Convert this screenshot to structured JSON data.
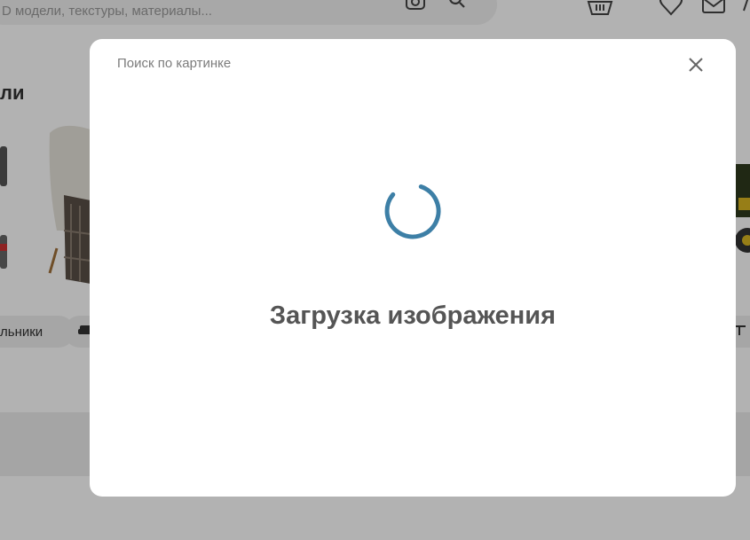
{
  "header": {
    "search_placeholder": "D модели, текстуры, материалы...",
    "icons": [
      "camera-search-icon",
      "search-icon",
      "basket-icon",
      "heart-icon",
      "mail-icon",
      "user-icon"
    ]
  },
  "background": {
    "section_title": "ли",
    "category_pills": [
      {
        "label": "льники"
      },
      {
        "label": ""
      },
      {
        "label": ""
      }
    ]
  },
  "modal": {
    "title": "Поиск по картинке",
    "loading_text": "Загрузка изображения",
    "close_icon": "close-icon",
    "spinner_color": "#3d7fa6"
  }
}
